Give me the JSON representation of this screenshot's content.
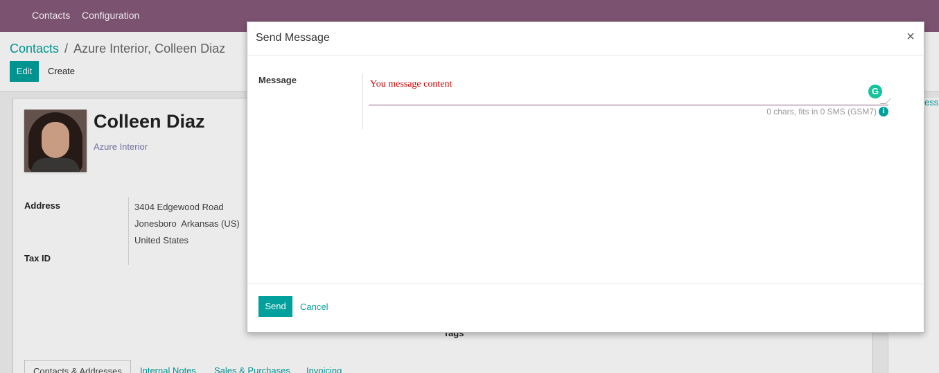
{
  "navbar": {
    "items": [
      "Contacts",
      "Configuration"
    ]
  },
  "control_panel": {
    "breadcrumb_root": "Contacts",
    "breadcrumb_separator": "/",
    "breadcrumb_current": "Azure Interior, Colleen Diaz",
    "edit_label": "Edit",
    "create_label": "Create"
  },
  "form": {
    "name": "Colleen Diaz",
    "company": "Azure Interior",
    "address_label": "Address",
    "address_lines": [
      "3404 Edgewood Road",
      "Jonesboro  Arkansas (US)",
      "United States"
    ],
    "tax_id_label": "Tax ID",
    "tags_label": "Tags",
    "right_panel_text": "ess",
    "tabs": [
      "Contacts & Addresses",
      "Internal Notes",
      "Sales & Purchases",
      "Invoicing"
    ]
  },
  "modal": {
    "title": "Send Message",
    "close_glyph": "×",
    "message_label": "Message",
    "message_placeholder": "You message content",
    "sms_info": "0 chars, fits in 0 SMS (GSM7)",
    "grammarly_glyph": "G",
    "info_glyph": "i",
    "send_label": "Send",
    "cancel_label": "Cancel"
  },
  "colors": {
    "navbar": "#875a7b",
    "accent": "#00a09d"
  }
}
